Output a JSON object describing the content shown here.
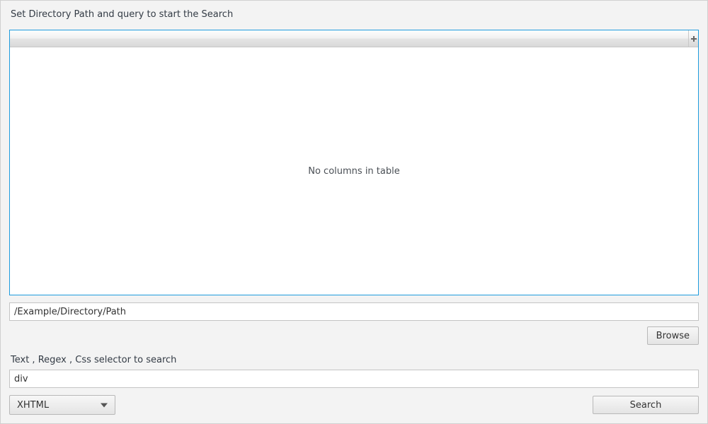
{
  "title": "Set Directory Path and query to start the Search",
  "table": {
    "empty_text": "No columns in table"
  },
  "path_input": {
    "value": "/Example/Directory/Path",
    "placeholder": ""
  },
  "browse_label": "Browse",
  "query_label": "Text , Regex , Css selector to search",
  "query_input": {
    "value": "div",
    "placeholder": ""
  },
  "mode_select": {
    "selected": "XHTML"
  },
  "search_label": "Search"
}
